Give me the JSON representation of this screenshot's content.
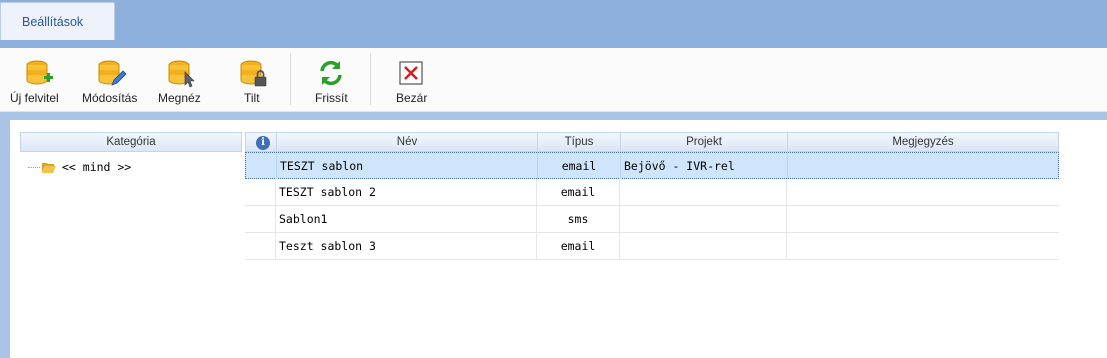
{
  "ribbon": {
    "tab_label": "Beállítások"
  },
  "toolbar": {
    "new_label": "Új felvitel",
    "edit_label": "Módosítás",
    "view_label": "Megnéz",
    "block_label": "Tilt",
    "refresh_label": "Frissít",
    "close_label": "Bezár"
  },
  "category": {
    "header": "Kategória",
    "items": [
      {
        "label": "<< mind >>",
        "icon": "folder-open-icon"
      }
    ]
  },
  "grid": {
    "columns": {
      "info": "i",
      "name": "Név",
      "type": "Típus",
      "project": "Projekt",
      "note": "Megjegyzés"
    },
    "rows": [
      {
        "name": "TESZT sablon",
        "type": "email",
        "project": "Bejövő - IVR-rel",
        "note": "",
        "selected": true
      },
      {
        "name": "TESZT sablon 2",
        "type": "email",
        "project": "",
        "note": ""
      },
      {
        "name": "Sablon1",
        "type": "sms",
        "project": "",
        "note": ""
      },
      {
        "name": "Teszt sablon 3",
        "type": "email",
        "project": "",
        "note": ""
      }
    ]
  },
  "colors": {
    "ribbon_bg": "#8cafdb",
    "selection": "#cfe5fb",
    "accent": "#2b5797",
    "refresh_green": "#2aa02a",
    "close_red": "#cc2222",
    "db_yellow": "#f2b01e"
  }
}
